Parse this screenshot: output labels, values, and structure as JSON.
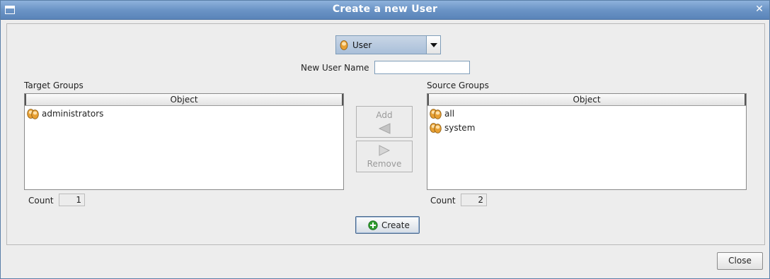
{
  "window": {
    "title": "Create a new User"
  },
  "type_select": {
    "value": "User",
    "icon": "user-icon"
  },
  "new_user_name": {
    "label": "New User Name",
    "value": ""
  },
  "target_groups": {
    "label": "Target Groups",
    "column_header": "Object",
    "rows": [
      {
        "name": "administrators",
        "icon": "group-icon"
      }
    ],
    "count_label": "Count",
    "count": "1"
  },
  "source_groups": {
    "label": "Source Groups",
    "column_header": "Object",
    "rows": [
      {
        "name": "all",
        "icon": "group-icon"
      },
      {
        "name": "system",
        "icon": "group-icon"
      }
    ],
    "count_label": "Count",
    "count": "2"
  },
  "add_button": {
    "label": "Add",
    "icon": "arrow-left-icon",
    "enabled": false
  },
  "remove_button": {
    "label": "Remove",
    "icon": "arrow-right-icon",
    "enabled": false
  },
  "create_button": {
    "label": "Create",
    "icon": "add-circle-icon"
  },
  "close_button": {
    "label": "Close"
  },
  "colors": {
    "titlebar": "#6b94c6",
    "create_icon": "#2e9b2e",
    "user_icon": "#e8a033"
  }
}
